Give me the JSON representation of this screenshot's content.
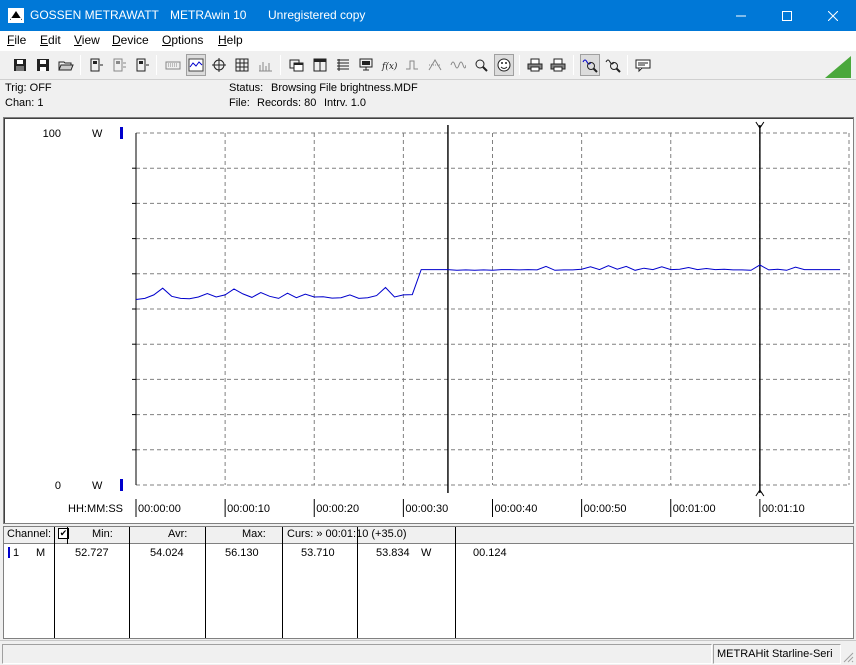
{
  "window": {
    "brand": "GOSSEN METRAWATT",
    "app_name": "METRAwin 10",
    "registration": "Unregistered copy"
  },
  "menu": {
    "file": {
      "key": "F",
      "rest": "ile"
    },
    "edit": {
      "key": "E",
      "rest": "dit"
    },
    "view": {
      "key": "V",
      "rest": "iew"
    },
    "device": {
      "key": "D",
      "rest": "evice"
    },
    "options": {
      "key": "O",
      "rest": "ptions"
    },
    "help": {
      "key": "H",
      "rest": "elp"
    }
  },
  "info": {
    "trig": "Trig: OFF",
    "chan": "Chan:  1",
    "status_label": "Status:",
    "status_value": "Browsing File brightness.MDF",
    "file_label": "File:",
    "records": "Records: 80",
    "interval": "Intrv. 1.0"
  },
  "chart_data": {
    "type": "line",
    "y_unit": "W",
    "y_max_label": "100",
    "y_min_label": "0",
    "ylim": [
      0,
      100
    ],
    "x_axis_label": "HH:MM:SS",
    "x_tick_labels": [
      "00:00:00",
      "00:00:10",
      "00:00:20",
      "00:00:30",
      "00:00:40",
      "00:00:50",
      "00:01:00",
      "00:01:10"
    ],
    "xlim": [
      0,
      80
    ],
    "grid": true,
    "cursor_1_x": 35,
    "cursor_2_x": 70,
    "line_color": "#0000cc",
    "series": [
      {
        "x": [
          0,
          1,
          2,
          3,
          4,
          5,
          6,
          7,
          8,
          9,
          10,
          11,
          12,
          13,
          14,
          15,
          16,
          17,
          18,
          19,
          20,
          21,
          22,
          23,
          24,
          25,
          26,
          27,
          28,
          29,
          30,
          31,
          32,
          33,
          34,
          35,
          36,
          37,
          38,
          39,
          40,
          41,
          42,
          43,
          44,
          45,
          46,
          47,
          48,
          49,
          50,
          51,
          52,
          53,
          54,
          55,
          56,
          57,
          58,
          59,
          60,
          61,
          62,
          63,
          64,
          65,
          66,
          67,
          68,
          69,
          70,
          71,
          72,
          73,
          74,
          75,
          76,
          77,
          78,
          79
        ],
        "values": [
          52.7,
          53.0,
          54.0,
          55.9,
          53.6,
          53.0,
          52.9,
          53.4,
          54.4,
          53.4,
          54.0,
          55.7,
          54.3,
          53.3,
          54.7,
          53.6,
          53.0,
          54.5,
          53.2,
          54.2,
          53.4,
          53.5,
          53.1,
          53.2,
          54.0,
          53.0,
          53.2,
          53.8,
          56.1,
          53.4,
          54.0,
          54.1,
          61.2,
          61.2,
          61.2,
          61.2,
          61.0,
          61.1,
          61.0,
          61.1,
          61.0,
          61.2,
          61.2,
          61.1,
          61.2,
          61.1,
          62.1,
          61.0,
          61.1,
          61.1,
          61.3,
          62.0,
          61.2,
          62.3,
          61.3,
          62.1,
          61.0,
          61.6,
          61.2,
          62.0,
          61.2,
          61.3,
          61.8,
          61.2,
          61.5,
          61.2,
          61.3,
          61.1,
          61.1,
          61.0,
          62.5,
          61.1,
          61.3,
          61.0,
          61.9,
          61.2,
          61.2,
          61.2,
          61.2,
          61.2
        ]
      }
    ]
  },
  "table": {
    "headers": {
      "channel": "Channel:",
      "check": "✔",
      "min": "Min:",
      "avg": "Avr:",
      "max": "Max:",
      "cursor": "Curs: » 00:01:10 (+35.0)"
    },
    "row": {
      "channel": "1",
      "mode": "M",
      "min": "52.727",
      "avg": "54.024",
      "max": "56.130",
      "cursor_value_1": "53.710",
      "cursor_value_2": "53.834",
      "unit": "W",
      "delta": "00.124"
    }
  },
  "statusbar": {
    "device": "METRAHit Starline-Seri"
  }
}
